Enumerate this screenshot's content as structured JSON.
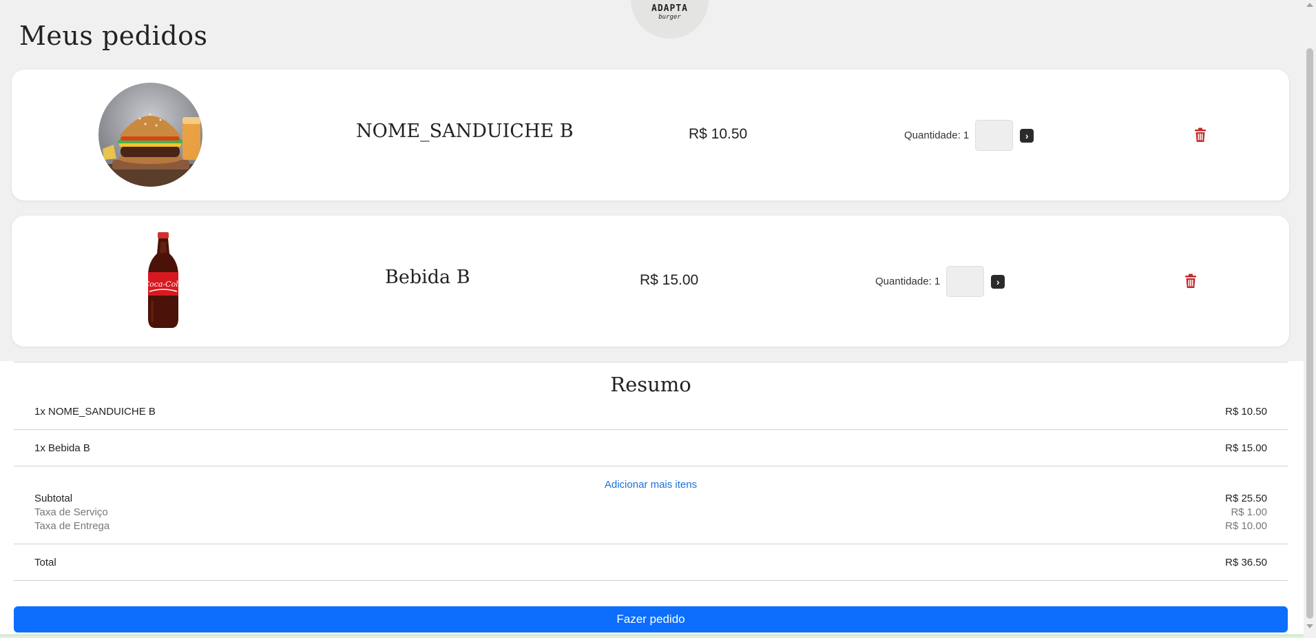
{
  "logo": {
    "text": "ADAPTA",
    "sub": "burger"
  },
  "page_title": "Meus pedidos",
  "items": [
    {
      "name": "NOME_SANDUICHE B",
      "price": "R$ 10.50",
      "quantity_label": "Quantidade: 1",
      "image": "burger-image"
    },
    {
      "name": "Bebida B",
      "price": "R$ 15.00",
      "quantity_label": "Quantidade: 1",
      "image": "soda-bottle-image"
    }
  ],
  "summary": {
    "title": "Resumo",
    "lines": [
      {
        "label": "1x NOME_SANDUICHE B",
        "value": "R$ 10.50"
      },
      {
        "label": "1x Bebida B",
        "value": "R$ 15.00"
      }
    ],
    "add_more": "Adicionar mais itens",
    "subtotal": {
      "label": "Subtotal",
      "value": "R$ 25.50"
    },
    "service_fee": {
      "label": "Taxa de Serviço",
      "value": "R$ 1.00"
    },
    "delivery_fee": {
      "label": "Taxa de Entrega",
      "value": "R$ 10.00"
    },
    "total": {
      "label": "Total",
      "value": "R$ 36.50"
    },
    "order_button": "Fazer pedido"
  },
  "colors": {
    "primary": "#0d6efd",
    "link": "#1a6fd9",
    "trash": "#c62828",
    "background": "#f0f0f0"
  }
}
